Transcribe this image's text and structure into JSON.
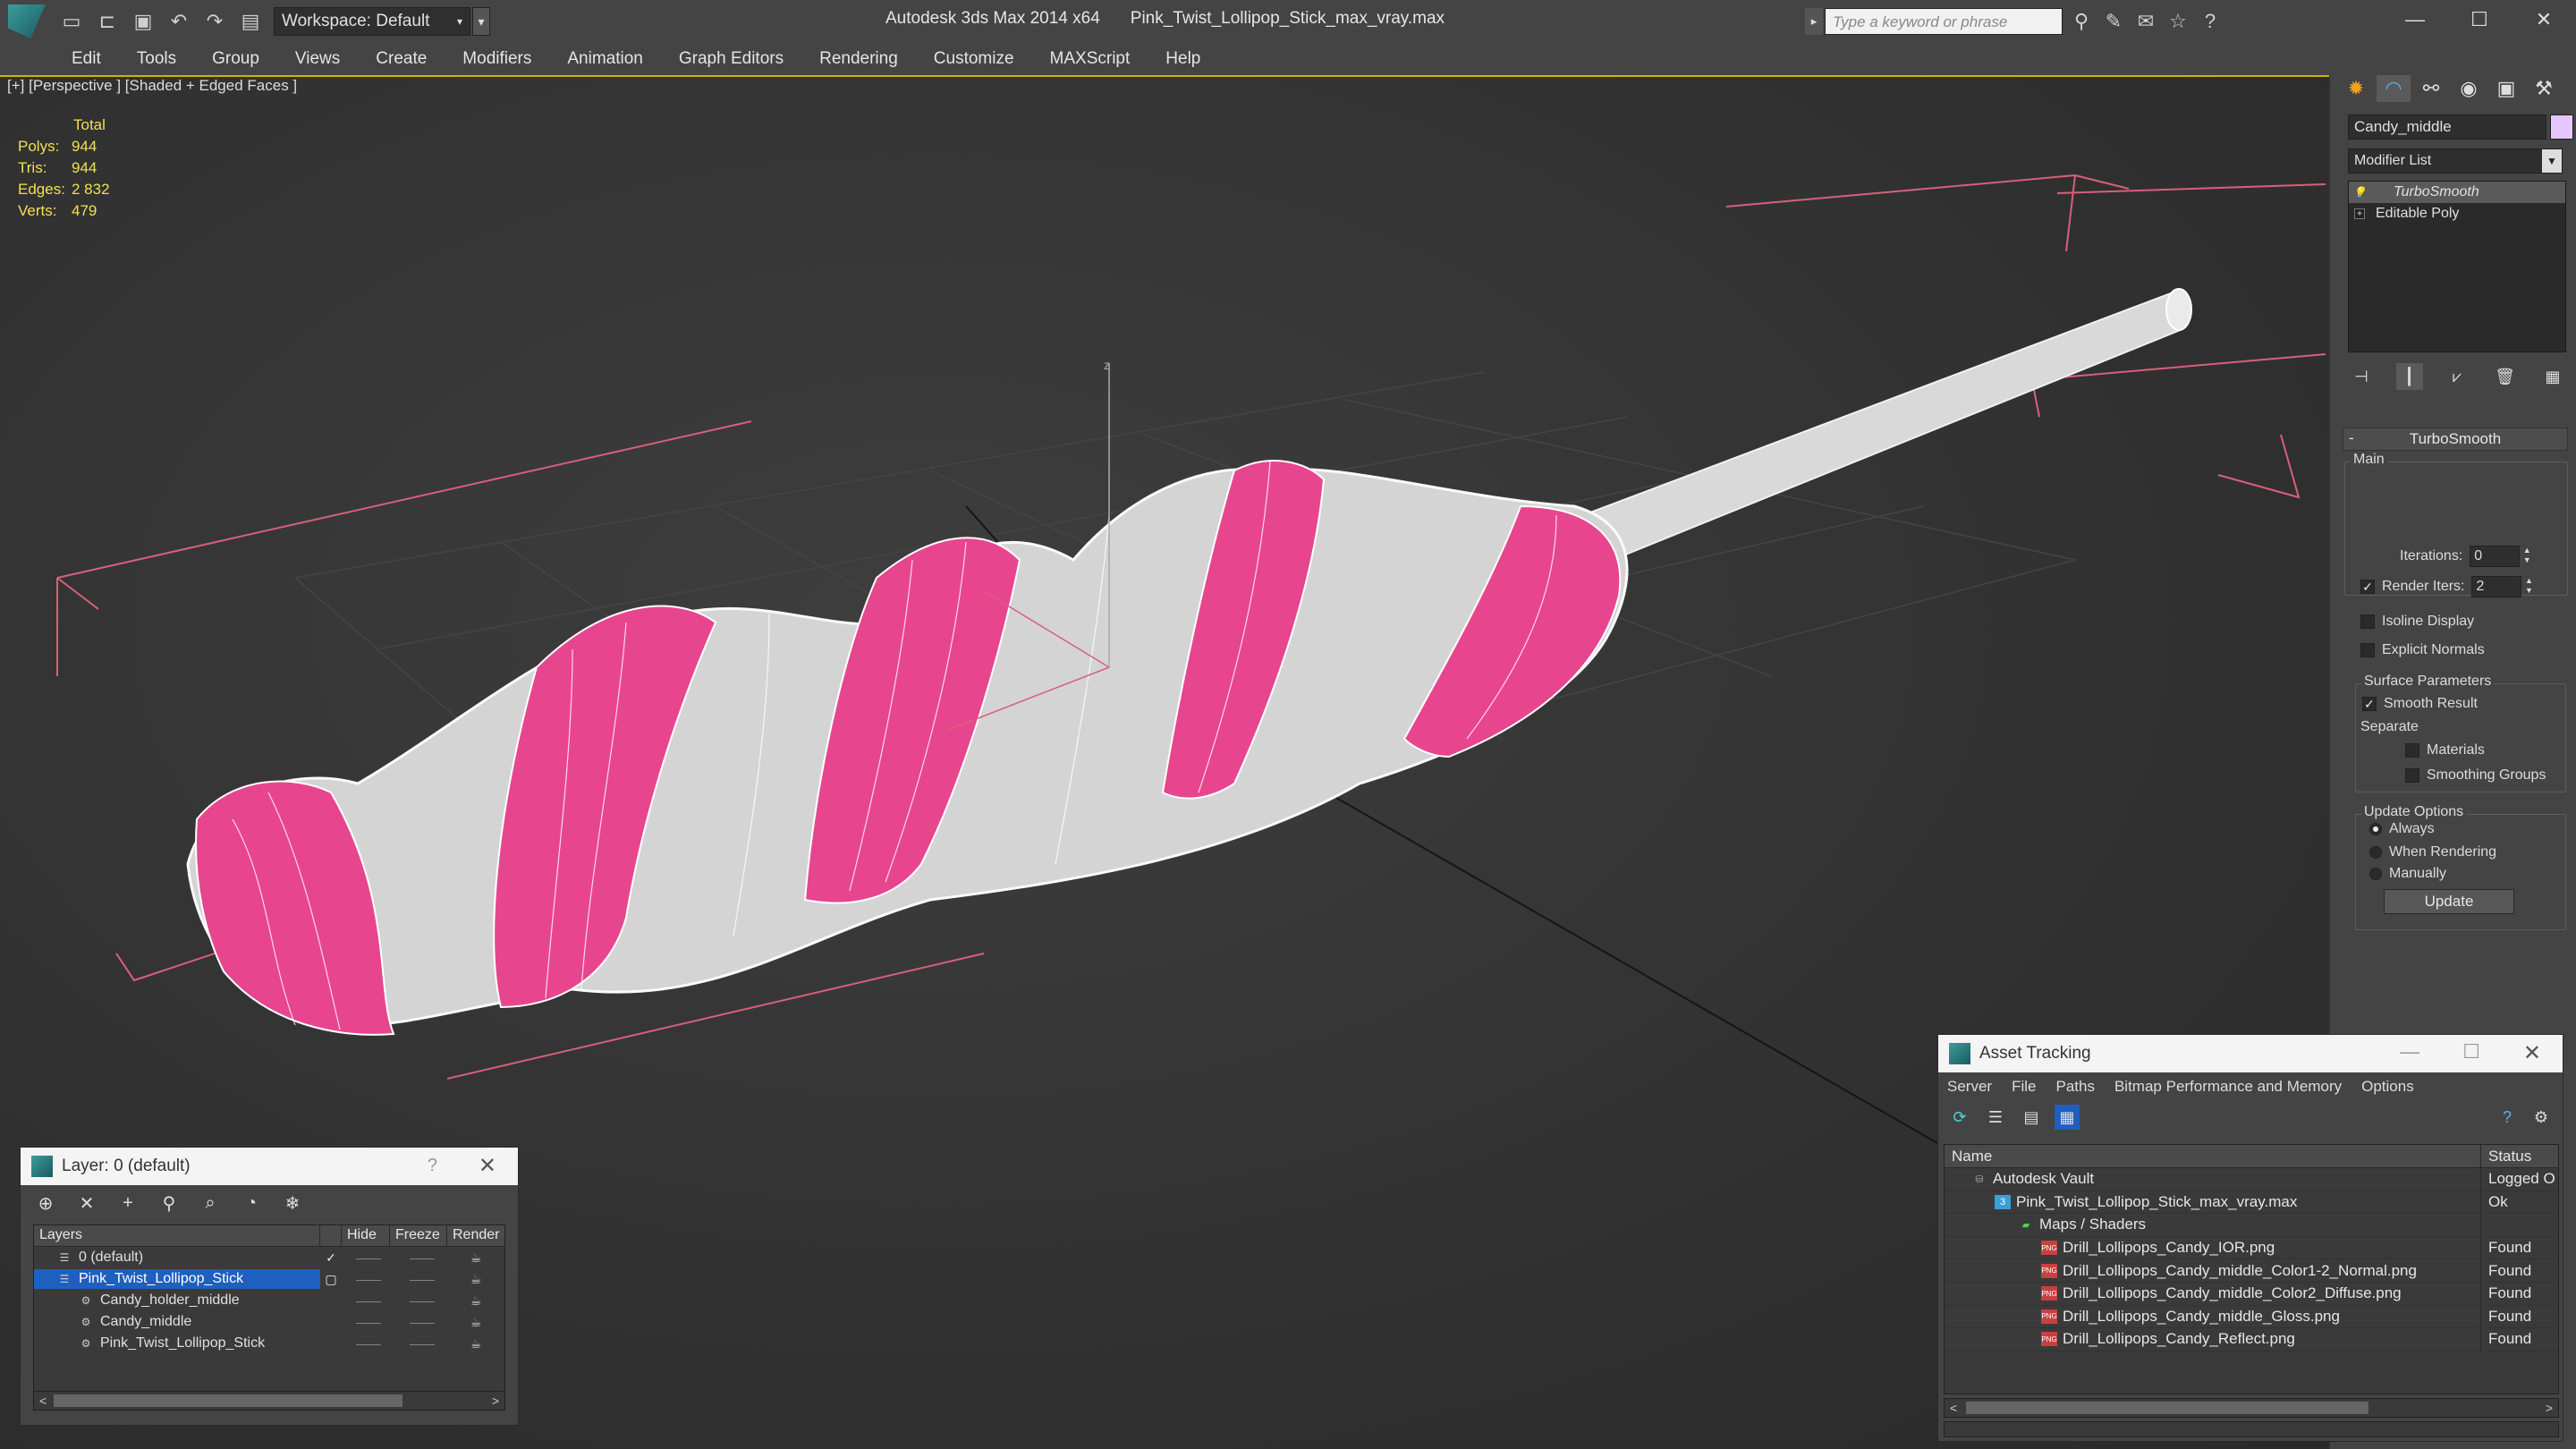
{
  "app": {
    "name": "Autodesk 3ds Max 2014 x64",
    "file": "Pink_Twist_Lollipop_Stick_max_vray.max",
    "workspace": "Workspace: Default",
    "search_placeholder": "Type a keyword or phrase"
  },
  "menu": [
    "Edit",
    "Tools",
    "Group",
    "Views",
    "Create",
    "Modifiers",
    "Animation",
    "Graph Editors",
    "Rendering",
    "Customize",
    "MAXScript",
    "Help"
  ],
  "viewport": {
    "label": "[+] [Perspective ] [Shaded + Edged Faces ]",
    "stats": {
      "header": "Total",
      "rows": [
        {
          "k": "Polys:",
          "v": "944"
        },
        {
          "k": "Tris:",
          "v": "944"
        },
        {
          "k": "Edges:",
          "v": "2 832"
        },
        {
          "k": "Verts:",
          "v": "479"
        }
      ]
    },
    "axis_label": "z",
    "colors": {
      "pink": "#e8458f",
      "white": "#e2e2e2",
      "bracket": "#d8607a"
    }
  },
  "command_panel": {
    "object_name": "Candy_middle",
    "modifier_list": "Modifier List",
    "stack": [
      {
        "label": "TurboSmooth",
        "selected": true
      },
      {
        "label": "Editable Poly",
        "selected": false
      }
    ],
    "rollout": "TurboSmooth",
    "main_group": "Main",
    "iterations_label": "Iterations:",
    "iterations_value": "0",
    "render_iters_label": "Render Iters:",
    "render_iters_value": "2",
    "isoline": "Isoline Display",
    "explicit_normals": "Explicit Normals",
    "surface_group": "Surface Parameters",
    "smooth_result": "Smooth Result",
    "separate": "Separate",
    "materials": "Materials",
    "smoothing_groups": "Smoothing Groups",
    "update_group": "Update Options",
    "always": "Always",
    "when_rendering": "When Rendering",
    "manually": "Manually",
    "update_btn": "Update"
  },
  "layer_dialog": {
    "title": "Layer: 0 (default)",
    "help": "?",
    "headers": {
      "layers": "Layers",
      "hide": "Hide",
      "freeze": "Freeze",
      "render": "Render"
    },
    "rows": [
      {
        "name": "0 (default)",
        "indent": 1
      },
      {
        "name": "Pink_Twist_Lollipop_Stick",
        "indent": 1
      },
      {
        "name": "Candy_holder_middle",
        "indent": 2
      },
      {
        "name": "Candy_middle",
        "indent": 2
      },
      {
        "name": "Pink_Twist_Lollipop_Stick",
        "indent": 2
      }
    ]
  },
  "asset_dialog": {
    "title": "Asset Tracking",
    "menu": [
      "Server",
      "File",
      "Paths",
      "Bitmap Performance and Memory",
      "Options"
    ],
    "col_name": "Name",
    "col_status": "Status",
    "rows": [
      {
        "name": "Autodesk Vault",
        "status": "Logged O",
        "icon": "vault",
        "indent": 1
      },
      {
        "name": "Pink_Twist_Lollipop_Stick_max_vray.max",
        "status": "Ok",
        "icon": "max",
        "indent": 2
      },
      {
        "name": "Maps / Shaders",
        "status": "",
        "icon": "maps",
        "indent": 3
      },
      {
        "name": "Drill_Lollipops_Candy_IOR.png",
        "status": "Found",
        "icon": "png",
        "indent": 4
      },
      {
        "name": "Drill_Lollipops_Candy_middle_Color1-2_Normal.png",
        "status": "Found",
        "icon": "png",
        "indent": 4
      },
      {
        "name": "Drill_Lollipops_Candy_middle_Color2_Diffuse.png",
        "status": "Found",
        "icon": "png",
        "indent": 4
      },
      {
        "name": "Drill_Lollipops_Candy_middle_Gloss.png",
        "status": "Found",
        "icon": "png",
        "indent": 4
      },
      {
        "name": "Drill_Lollipops_Candy_Reflect.png",
        "status": "Found",
        "icon": "png",
        "indent": 4
      }
    ]
  }
}
